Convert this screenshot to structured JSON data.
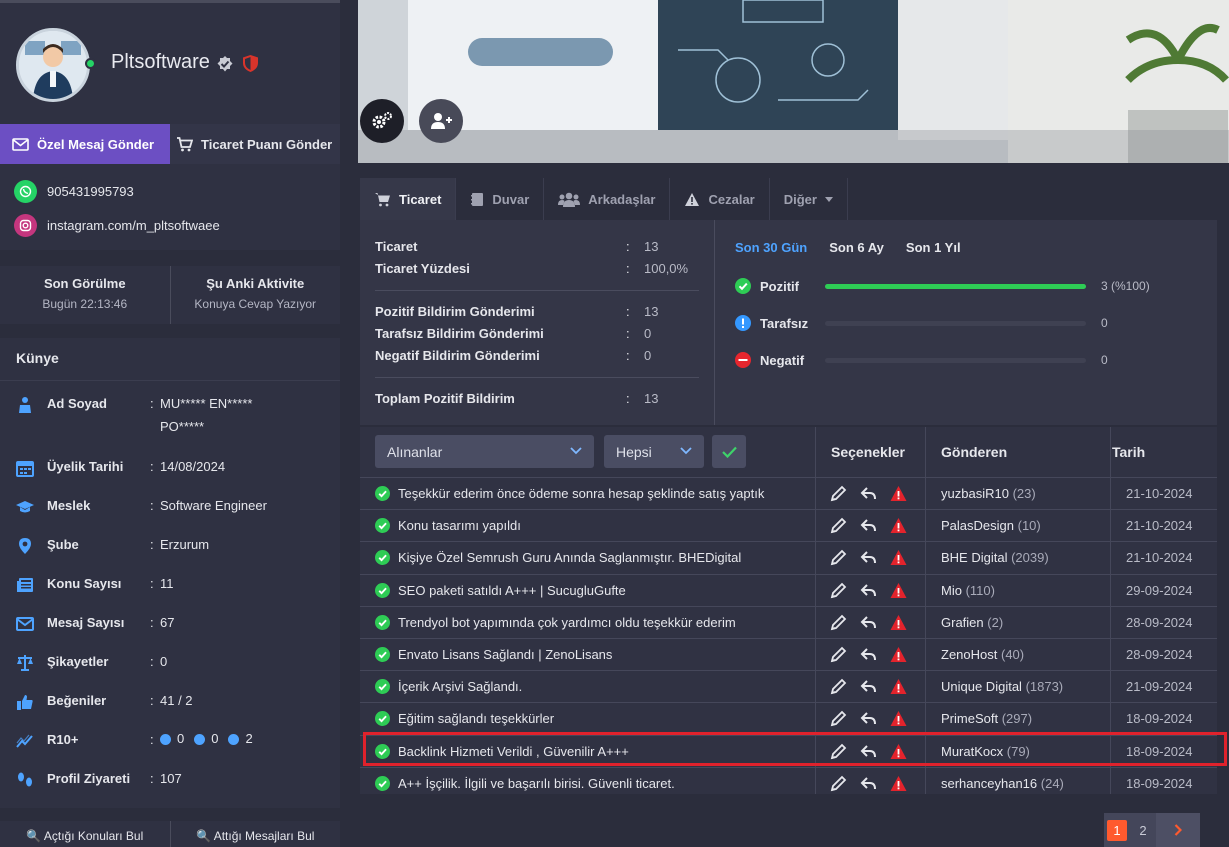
{
  "profile": {
    "username": "Pltsoftware",
    "send_dm_label": "Özel Mesaj Gönder",
    "send_trade_label": "Ticaret Puanı Gönder",
    "phone": "905431995793",
    "instagram": "instagram.com/m_pltsoftwaee"
  },
  "presence": {
    "last_seen_title": "Son Görülme",
    "last_seen_value": "Bugün 22:13:46",
    "activity_title": "Şu Anki Aktivite",
    "activity_value": "Konuya Cevap Yazıyor"
  },
  "kunye": {
    "title": "Künye",
    "rows": [
      {
        "label": "Ad Soyad",
        "value": "MU***** EN***** PO*****",
        "icon": "user-icon"
      },
      {
        "label": "Üyelik Tarihi",
        "value": "14/08/2024",
        "icon": "calendar-icon"
      },
      {
        "label": "Meslek",
        "value": "Software Engineer",
        "icon": "graduation-cap-icon"
      },
      {
        "label": "Şube",
        "value": "Erzurum",
        "icon": "map-pin-icon"
      },
      {
        "label": "Konu Sayısı",
        "value": "11",
        "icon": "newspaper-icon"
      },
      {
        "label": "Mesaj Sayısı",
        "value": "67",
        "icon": "envelope-icon"
      },
      {
        "label": "Şikayetler",
        "value": "0",
        "icon": "scale-icon"
      },
      {
        "label": "Beğeniler",
        "value": "41 / 2",
        "icon": "thumbs-up-icon"
      },
      {
        "label": "R10+",
        "value": "",
        "icon": "chart-line-icon"
      },
      {
        "label": "Profil Ziyareti",
        "value": "107",
        "icon": "footprints-icon"
      }
    ],
    "r10": [
      "0",
      "0",
      "2"
    ]
  },
  "bottom_buttons": {
    "topics": "Açtığı Konuları Bul",
    "messages": "Attığı Mesajları Bul"
  },
  "tabs": [
    "Ticaret",
    "Duvar",
    "Arkadaşlar",
    "Cezalar",
    "Diğer"
  ],
  "stats": {
    "rows": [
      {
        "label": "Ticaret",
        "value": "13"
      },
      {
        "label": "Ticaret Yüzdesi",
        "value": "100,0%"
      },
      {
        "label": "Pozitif Bildirim Gönderimi",
        "value": "13"
      },
      {
        "label": "Tarafsız Bildirim Gönderimi",
        "value": "0"
      },
      {
        "label": "Negatif Bildirim Gönderimi",
        "value": "0"
      },
      {
        "label": "Toplam Pozitif Bildirim",
        "value": "13"
      }
    ],
    "periods": [
      "Son 30 Gün",
      "Son 6 Ay",
      "Son 1 Yıl"
    ],
    "bars": [
      {
        "label": "Pozitif",
        "count": "3 (%100)",
        "fraction": 1.0,
        "color": "#2ecc55"
      },
      {
        "label": "Tarafsız",
        "count": "0",
        "fraction": 0,
        "color": "#3498ff"
      },
      {
        "label": "Negatif",
        "count": "0",
        "fraction": 0,
        "color": "#e6262e"
      }
    ]
  },
  "table": {
    "filter_type": "Alınanlar",
    "filter_scope": "Hepsi",
    "headers": {
      "options": "Seçenekler",
      "sender": "Gönderen",
      "date": "Tarih"
    },
    "rows": [
      {
        "desc": "Teşekkür ederim önce ödeme sonra hesap şeklinde satış yaptık",
        "sender": "yuzbasiR10",
        "count": "(23)",
        "date": "21-10-2024"
      },
      {
        "desc": "Konu tasarımı yapıldı",
        "sender": "PalasDesign",
        "count": "(10)",
        "date": "21-10-2024"
      },
      {
        "desc": "Kişiye Özel Semrush Guru Anında Saglanmıştır. BHEDigital",
        "sender": "BHE Digital",
        "count": "(2039)",
        "date": "21-10-2024"
      },
      {
        "desc": "SEO paketi satıldı A+++ | SucugluGufte",
        "sender": "Mio",
        "count": "(110)",
        "date": "29-09-2024"
      },
      {
        "desc": "Trendyol bot yapımında çok yardımcı oldu teşekkür ederim",
        "sender": "Grafien",
        "count": "(2)",
        "date": "28-09-2024"
      },
      {
        "desc": "Envato Lisans Sağlandı | ZenoLisans",
        "sender": "ZenoHost",
        "count": "(40)",
        "date": "28-09-2024"
      },
      {
        "desc": "İçerik Arşivi Sağlandı.",
        "sender": "Unique Digital",
        "count": "(1873)",
        "date": "21-09-2024"
      },
      {
        "desc": "Eğitim sağlandı teşekkürler",
        "sender": "PrimeSoft",
        "count": "(297)",
        "date": "18-09-2024"
      },
      {
        "desc": "Backlink Hizmeti Verildi , Güvenilir A+++",
        "sender": "MuratKocx",
        "count": "(79)",
        "date": "18-09-2024"
      },
      {
        "desc": "A++ İşçilik. İlgili ve başarılı birisi. Güvenli ticaret.",
        "sender": "serhanceyhan16",
        "count": "(24)",
        "date": "18-09-2024"
      }
    ]
  },
  "pagination": {
    "pages": [
      "1",
      "2"
    ],
    "current": "1"
  },
  "colors": {
    "accent": "#6c4fc3",
    "positive": "#2ecc55",
    "highlight": "#e0222c",
    "link": "#4ea3ff"
  }
}
